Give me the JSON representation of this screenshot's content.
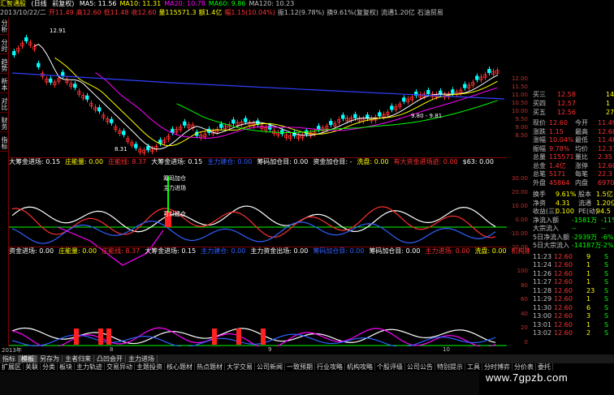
{
  "window": {
    "title": "汇智通股",
    "tabs": [
      "(日线",
      "前复权)"
    ],
    "ma_labels": [
      {
        "text": "MA5: 11.56",
        "color": "#ffffff"
      },
      {
        "text": "MA10: 11.31",
        "color": "#ffff00"
      },
      {
        "text": "MA20: 10.78",
        "color": "#ff00ff"
      },
      {
        "text": "MA60: 9.86",
        "color": "#00ff00"
      },
      {
        "text": "MA120: 10.23",
        "color": "#c0c0c0"
      }
    ]
  },
  "infobar": {
    "items": [
      {
        "text": "2013/10/22/二",
        "color": "#c0c0c0"
      },
      {
        "text": "开11.49",
        "color": "#ff3030"
      },
      {
        "text": "高12.60",
        "color": "#ff3030"
      },
      {
        "text": "低11.48",
        "color": "#ff3030"
      },
      {
        "text": "收12.60",
        "color": "#ff3030"
      },
      {
        "text": "量115571.3",
        "color": "#ffff00"
      },
      {
        "text": "额1.4亿",
        "color": "#ffff00"
      },
      {
        "text": "幅1.15(10.04%)",
        "color": "#ff3030"
      },
      {
        "text": "振1.12(9.78%)",
        "color": "#c0c0c0"
      },
      {
        "text": "换9.61%(复复权)",
        "color": "#c0c0c0"
      },
      {
        "text": "流通1.20亿",
        "color": "#c0c0c0"
      },
      {
        "text": "石油贸易",
        "color": "#c0c0c0"
      }
    ]
  },
  "left_tabs": [
    "分析",
    "分时",
    "趋势",
    "新本",
    "对比",
    "财务",
    "指标"
  ],
  "price_chart": {
    "label_high": "12.91",
    "label_low": "8.31",
    "label_mid": "9.80 - 9.81",
    "candles_up_color": "#ff3030",
    "candles_down_color": "#00ffff"
  },
  "ind1": {
    "title": [
      {
        "text": "大筹金进场: 0.15",
        "color": "#ffffff"
      },
      {
        "text": "庄能量: 0.00",
        "color": "#ffff00"
      },
      {
        "text": "庄能线: 8.37",
        "color": "#ff3030"
      },
      {
        "text": "大筹金进场: 0.15",
        "color": "#ffffff"
      },
      {
        "text": "主力建仓: 0.00",
        "color": "#3060ff"
      },
      {
        "text": "筹码加仓目: 0.00",
        "color": "#ffffff"
      },
      {
        "text": "资金加仓目: -",
        "color": "#ffffff"
      },
      {
        "text": "洗盘: 0.00",
        "color": "#ffff00"
      },
      {
        "text": "有大资金进场迹: 0.00",
        "color": "#ff3030"
      },
      {
        "text": "$63: 0.00",
        "color": "#ffffff"
      }
    ],
    "annotations": [
      "筹码加仓",
      "主力进场",
      "可以建仓"
    ]
  },
  "ind2": {
    "title": [
      {
        "text": "资金进场: 0.00",
        "color": "#ffffff"
      },
      {
        "text": "庄能量: 0.00",
        "color": "#ffff00"
      },
      {
        "text": "庄能线: 8.37",
        "color": "#ff3030"
      },
      {
        "text": "大筹金进场: 0.15",
        "color": "#ffffff"
      },
      {
        "text": "主力建仓: 0.00",
        "color": "#3060ff"
      },
      {
        "text": "主力资金出场: 0.00",
        "color": "#ffffff"
      },
      {
        "text": "筹码加仓目: 0.00",
        "color": "#3060ff"
      },
      {
        "text": "筹码加仓目: 0.00",
        "color": "#ffffff"
      },
      {
        "text": "主力进场: 0.00",
        "color": "#ff3030"
      },
      {
        "text": "洗盘: 0.00",
        "color": "#ffff00"
      },
      {
        "text": "机构建仓区: 0",
        "color": "#ff3030"
      }
    ]
  },
  "axis": {
    "price_ticks": [
      "12.00",
      "11.50",
      "11.00",
      "10.50",
      "10.00",
      "9.50",
      "9.00",
      "8.50"
    ],
    "ind1_ticks": [
      "30.00",
      "20.00",
      "10.00",
      "0.00",
      "-10.00",
      "-20.00"
    ],
    "ind2_ticks": [
      "100",
      "80",
      "60",
      "40",
      "20",
      "0"
    ]
  },
  "quote_panel": {
    "order_book": [
      {
        "label": "买三",
        "price": "12.58",
        "vol": "14"
      },
      {
        "label": "买四",
        "price": "12.57",
        "vol": "1"
      },
      {
        "label": "买五",
        "price": "12.56",
        "vol": "27"
      }
    ],
    "stats": [
      {
        "l1": "现价",
        "v1": "12.60",
        "l2": "今开",
        "v2": "11.49"
      },
      {
        "l1": "涨跌",
        "v1": "1.15",
        "l2": "最高",
        "v2": "12.60"
      },
      {
        "l1": "涨幅",
        "v1": "10.04%",
        "l2": "最低",
        "v2": "11.48"
      },
      {
        "l1": "振幅",
        "v1": "9.78%",
        "l2": "均价",
        "v2": "12.37"
      },
      {
        "l1": "总量",
        "v1": "115571",
        "l2": "量比",
        "v2": "2.35"
      },
      {
        "l1": "总金",
        "v1": "1.4亿",
        "l2": "涨停",
        "v2": "12.60"
      },
      {
        "l1": "总笔",
        "v1": "5171",
        "l2": "每笔",
        "v2": "22.3"
      },
      {
        "l1": "外盘",
        "v1": "45864",
        "l2": "内盘",
        "v2": "69707"
      }
    ],
    "extra": [
      {
        "l1": "换手",
        "v1": "9.61%",
        "l2": "股本",
        "v2": "1.5亿"
      },
      {
        "l1": "净资",
        "v1": "4.31",
        "l2": "流通",
        "v2": "1.20亿"
      },
      {
        "l1": "收益(三)",
        "v1": "0.100",
        "l2": "PE(动)",
        "v2": "94.5"
      }
    ],
    "flows": [
      {
        "label": "净流入额",
        "value": "-1581万",
        "extra": "-11%"
      },
      {
        "label": "大宗流入",
        "value": "--",
        "extra": "--"
      },
      {
        "label": "5日净流入额",
        "value": "-2939万",
        "extra": "-6%"
      },
      {
        "label": "5日大宗流入",
        "value": "-14187万",
        "extra": "-2%"
      }
    ],
    "ticks": [
      {
        "time": "11:23",
        "price": "12.60",
        "vol": "9",
        "bs": "S"
      },
      {
        "time": "11:24",
        "price": "12.60",
        "vol": "1",
        "bs": "S"
      },
      {
        "time": "11:26",
        "price": "12.60",
        "vol": "1",
        "bs": "S"
      },
      {
        "time": "11:27",
        "price": "12.60",
        "vol": "1",
        "bs": "S"
      },
      {
        "time": "11:28",
        "price": "12.60",
        "vol": "23",
        "bs": "S"
      },
      {
        "time": "11:29",
        "price": "12.60",
        "vol": "1",
        "bs": "S"
      },
      {
        "time": "11:30",
        "price": "12.60",
        "vol": "6",
        "bs": "S"
      },
      {
        "time": "13:00",
        "price": "12.60",
        "vol": "3",
        "bs": "S"
      },
      {
        "time": "13:01",
        "price": "12.60",
        "vol": "1",
        "bs": "S"
      },
      {
        "time": "13:02",
        "price": "12.60",
        "vol": "2",
        "bs": "S"
      }
    ]
  },
  "time_axis": [
    "2013年",
    "8",
    "9",
    "10"
  ],
  "bottom_tabs": [
    {
      "label": "指标",
      "active": false
    },
    {
      "label": "模板",
      "active": true
    },
    {
      "label": "另存为",
      "active": false
    },
    {
      "label": "主者归来",
      "active": false
    },
    {
      "label": "凸凹会开",
      "active": false
    },
    {
      "label": "主力进场",
      "active": false
    }
  ],
  "nav_tabs": [
    "扩展区",
    "关联",
    "分类",
    "板块",
    "主力轨迹",
    "交易异动",
    "主题投资",
    "核心题材",
    "热点题材",
    "大学交易",
    "公司新闻",
    "一致预期",
    "行业攻略",
    "机构攻略",
    "个股评级",
    "公司公告",
    "特别提示",
    "工具",
    "分时博弈",
    "分价表",
    "委托"
  ],
  "watermark": "www.7gpzb.com"
}
